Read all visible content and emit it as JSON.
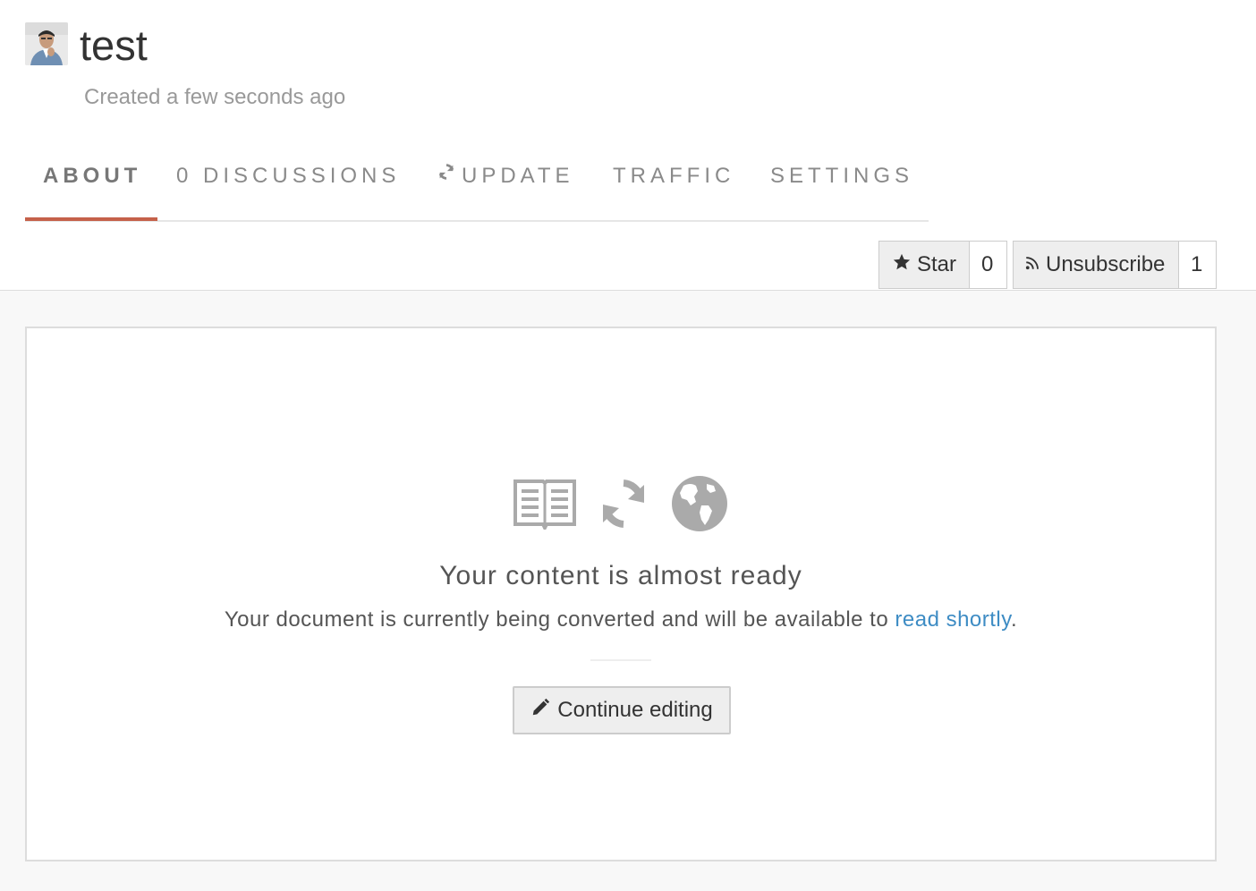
{
  "header": {
    "title": "test",
    "subtitle": "Created a few seconds ago"
  },
  "tabs": [
    {
      "label": "ABOUT",
      "active": true
    },
    {
      "label": "0 DISCUSSIONS",
      "active": false
    },
    {
      "label": "UPDATE",
      "active": false,
      "icon": "refresh-icon"
    },
    {
      "label": "TRAFFIC",
      "active": false
    },
    {
      "label": "SETTINGS",
      "active": false
    }
  ],
  "actions": {
    "star_label": "Star",
    "star_count": "0",
    "subscribe_label": "Unsubscribe",
    "subscribe_count": "1"
  },
  "main": {
    "icons": [
      "book-icon",
      "refresh-icon",
      "globe-icon"
    ],
    "headline": "Your content is almost ready",
    "message_prefix": "Your document is currently being converted and will be available to ",
    "message_link": "read shortly",
    "message_suffix": ".",
    "continue_label": "Continue editing"
  },
  "colors": {
    "accent": "#c5614a",
    "link": "#3e8cc4",
    "icon_gray": "#aaaaaa"
  }
}
